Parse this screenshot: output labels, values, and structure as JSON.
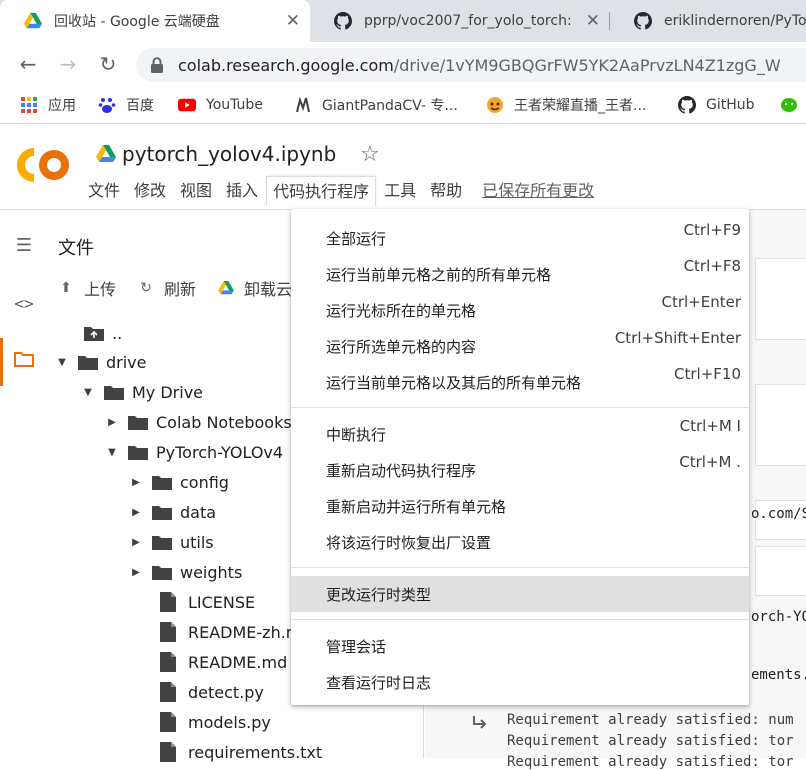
{
  "browser": {
    "tabs": [
      {
        "title": "回收站 - Google 云端硬盘",
        "active": true
      },
      {
        "title": "pprp/voc2007_for_yolo_torch:",
        "active": false
      },
      {
        "title": "eriklindernoren/PyTor",
        "active": false
      }
    ],
    "url_host": "colab.research.google.com",
    "url_path": "/drive/1vYM9GBQGrFW5YK2AaPrvzLN4Z1zgG_W",
    "bookmarks": [
      "应用",
      "百度",
      "YouTube",
      "GiantPandaCV- 专...",
      "王者荣耀直播_王者...",
      "GitHub"
    ]
  },
  "colab": {
    "logo_text": "CO",
    "notebook_title": "pytorch_yolov4.ipynb",
    "menu": [
      "文件",
      "修改",
      "视图",
      "插入",
      "代码执行程序",
      "工具",
      "帮助"
    ],
    "saved_status": "已保存所有更改"
  },
  "files": {
    "title": "文件",
    "actions": [
      "上传",
      "刷新",
      "卸载云"
    ],
    "tree": [
      {
        "label": "..",
        "kind": "up"
      },
      {
        "label": "drive",
        "kind": "folder"
      },
      {
        "label": "My Drive",
        "kind": "folder"
      },
      {
        "label": "Colab Notebooks",
        "kind": "folder"
      },
      {
        "label": "PyTorch-YOLOv4",
        "kind": "folder"
      },
      {
        "label": "config",
        "kind": "folder"
      },
      {
        "label": "data",
        "kind": "folder"
      },
      {
        "label": "utils",
        "kind": "folder"
      },
      {
        "label": "weights",
        "kind": "folder"
      },
      {
        "label": "LICENSE",
        "kind": "file"
      },
      {
        "label": "README-zh.md",
        "kind": "file"
      },
      {
        "label": "README.md",
        "kind": "file"
      },
      {
        "label": "detect.py",
        "kind": "file"
      },
      {
        "label": "models.py",
        "kind": "file"
      },
      {
        "label": "requirements.txt",
        "kind": "file"
      }
    ]
  },
  "notebook": {
    "frag_url": "o.com/S",
    "frag_torch": "orch-YO",
    "frag_req": "ements.",
    "output_lines": [
      "Requirement already satisfied: num",
      "Requirement already satisfied: tor",
      "Requirement already satisfied: tor"
    ]
  },
  "runtime_menu": {
    "items": [
      {
        "label": "全部运行",
        "shortcut": "Ctrl+F9"
      },
      {
        "label": "运行当前单元格之前的所有单元格",
        "shortcut": "Ctrl+F8"
      },
      {
        "label": "运行光标所在的单元格",
        "shortcut": "Ctrl+Enter"
      },
      {
        "label": "运行所选单元格的内容",
        "shortcut": "Ctrl+Shift+Enter"
      },
      {
        "label": "运行当前单元格以及其后的所有单元格",
        "shortcut": "Ctrl+F10"
      },
      {
        "label": "中断执行",
        "shortcut": "Ctrl+M I"
      },
      {
        "label": "重新启动代码执行程序",
        "shortcut": "Ctrl+M ."
      },
      {
        "label": "重新启动并运行所有单元格",
        "shortcut": ""
      },
      {
        "label": "将该运行时恢复出厂设置",
        "shortcut": ""
      },
      {
        "label": "更改运行时类型",
        "shortcut": ""
      },
      {
        "label": "管理会话",
        "shortcut": ""
      },
      {
        "label": "查看运行时日志",
        "shortcut": ""
      }
    ]
  },
  "colors": {
    "colab_orange": "#f9ab00",
    "colab_dark_orange": "#e8710a",
    "highlight": "#e0e0e0"
  }
}
